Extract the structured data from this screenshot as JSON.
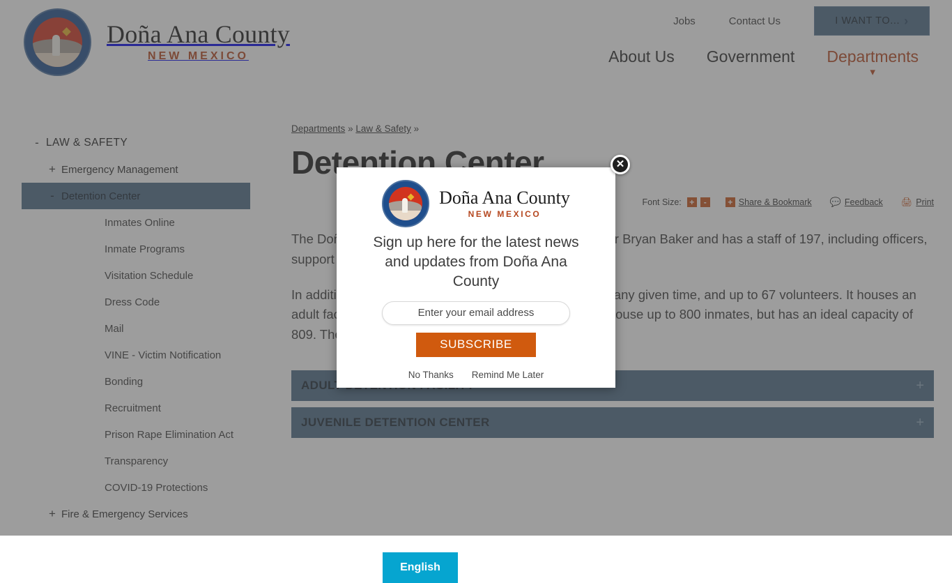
{
  "header": {
    "logo_title": "Doña Ana County",
    "logo_sub": "NEW MEXICO",
    "util_links": [
      {
        "label": "Jobs"
      },
      {
        "label": "Contact Us"
      }
    ],
    "iwant_label": "I WANT TO...",
    "iwant_chevron": "chevron-right-icon",
    "main_nav": [
      {
        "label": "About Us",
        "active": false
      },
      {
        "label": "Government",
        "active": false
      },
      {
        "label": "Departments",
        "active": true
      }
    ],
    "accent_color": "#b5471f",
    "button_color": "#4d6a86"
  },
  "sidebar": {
    "items": [
      {
        "label": "LAW & SAFETY",
        "marker": "-",
        "level": 0,
        "current": false
      },
      {
        "label": "Emergency Management",
        "marker": "+",
        "level": 1,
        "current": false
      },
      {
        "label": "Detention Center",
        "marker": "-",
        "level": 1,
        "current": true
      },
      {
        "label": "Inmates Online",
        "marker": "",
        "level": 2,
        "current": false
      },
      {
        "label": "Inmate Programs",
        "marker": "",
        "level": 2,
        "current": false
      },
      {
        "label": "Visitation Schedule",
        "marker": "",
        "level": 2,
        "current": false
      },
      {
        "label": "Dress Code",
        "marker": "",
        "level": 2,
        "current": false
      },
      {
        "label": "Mail",
        "marker": "",
        "level": 2,
        "current": false
      },
      {
        "label": "VINE - Victim Notification",
        "marker": "",
        "level": 2,
        "current": false
      },
      {
        "label": "Bonding",
        "marker": "",
        "level": 2,
        "current": false
      },
      {
        "label": "Recruitment",
        "marker": "",
        "level": 2,
        "current": false
      },
      {
        "label": "Prison Rape Elimination Act",
        "marker": "",
        "level": 2,
        "current": false
      },
      {
        "label": "Transparency",
        "marker": "",
        "level": 2,
        "current": false
      },
      {
        "label": "COVID-19 Protections",
        "marker": "",
        "level": 2,
        "current": false
      },
      {
        "label": "Fire & Emergency Services",
        "marker": "+",
        "level": 1,
        "current": false
      }
    ]
  },
  "main": {
    "breadcrumb": [
      {
        "label": "Departments",
        "link": true
      },
      {
        "label": "»",
        "link": false
      },
      {
        "label": "Law & Safety",
        "link": true
      },
      {
        "label": "»",
        "link": false
      }
    ],
    "title": "Detention Center",
    "toolbar": {
      "font_size_label": "Font Size:",
      "increase": "+",
      "decrease": "-",
      "share_plus": "+",
      "share_label": "Share & Bookmark",
      "feedback_icon": "comment-icon",
      "feedback_label": "Feedback",
      "print_icon": "printer-icon",
      "print_label": "Print",
      "icon_color": "#c8541c"
    },
    "paragraphs": [
      "The Doña Ana County Detention Center is led by Director Bryan Baker and has a staff of 197, including officers, support staff, and medical staff.",
      "In addition, the facility has 61 contract personnel and, at any given time, and up to 67 volunteers. It houses an adult facility and a juvenile facility.  The adult facility can house up to 800 inmates, but has an ideal capacity of 809. The juvenile facility has a capacity of 50."
    ],
    "accordions": [
      {
        "title": "ADULT DETENTION FACILITY",
        "toggle": "+"
      },
      {
        "title": "JUVENILE DETENTION CENTER",
        "toggle": "+"
      }
    ],
    "language_button": "English",
    "language_color": "#06a5d0"
  },
  "modal": {
    "close_icon": "close-icon",
    "logo_title": "Doña Ana County",
    "logo_sub": "NEW MEXICO",
    "headline": "Sign up here for the latest news and updates from Doña Ana County",
    "email_placeholder": "Enter your email address",
    "email_value": "",
    "subscribe_label": "SUBSCRIBE",
    "subscribe_color": "#d05a0e",
    "no_thanks_label": "No Thanks",
    "remind_label": "Remind Me Later"
  }
}
